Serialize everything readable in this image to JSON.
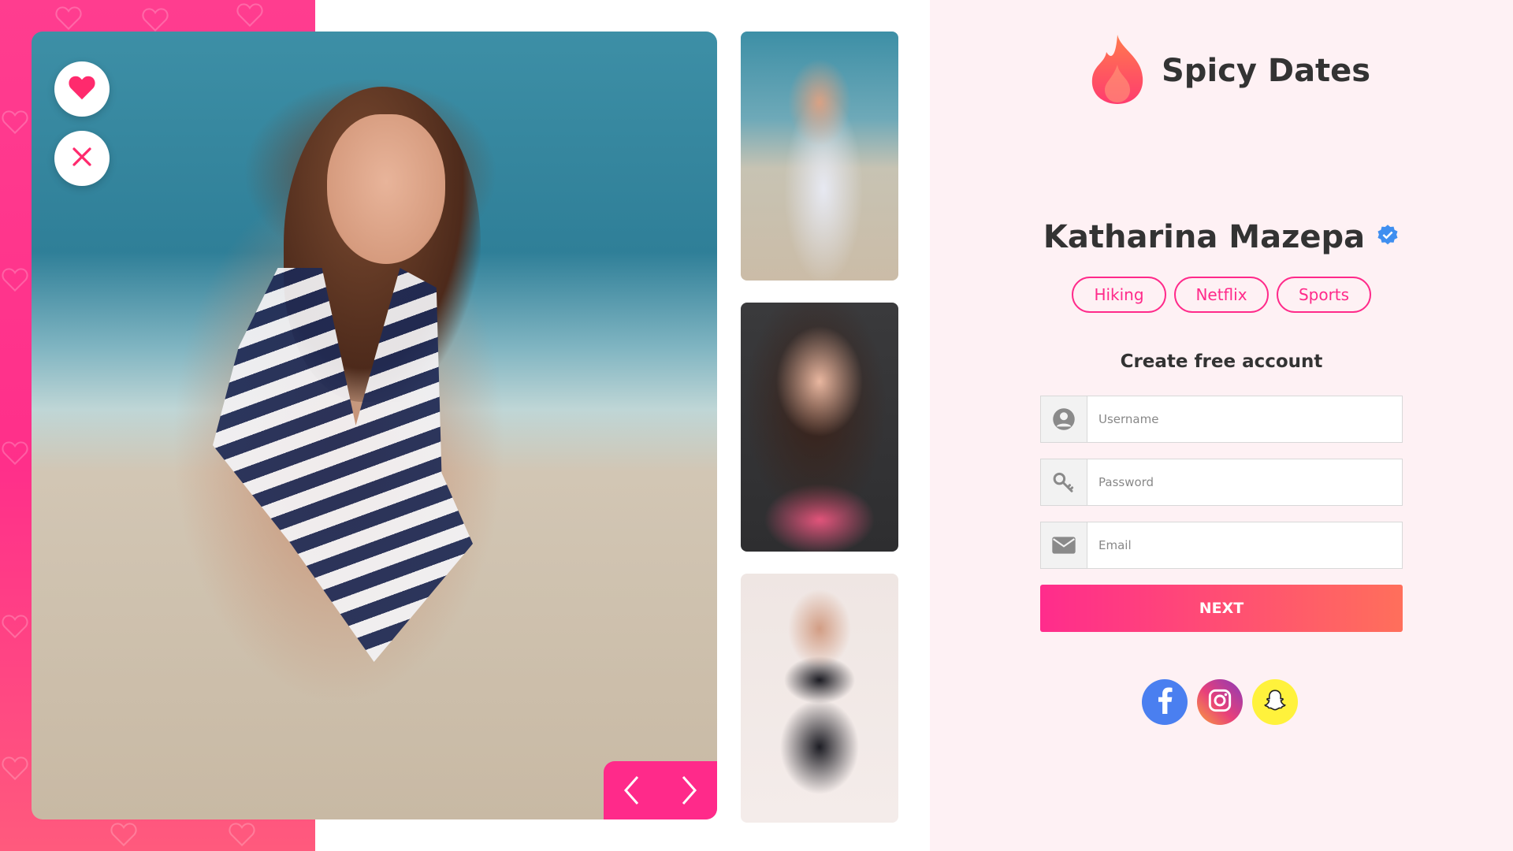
{
  "brand": {
    "name": "Spicy Dates",
    "logo_icon": "flame-icon"
  },
  "profile": {
    "name": "Katharina Mazepa",
    "verified_icon": "verified-badge-icon",
    "interests": [
      "Hiking",
      "Netflix",
      "Sports"
    ]
  },
  "photos": {
    "main_alt": "main-profile-photo",
    "thumbnails": [
      "thumbnail-1",
      "thumbnail-2",
      "thumbnail-3"
    ]
  },
  "actions": {
    "like_icon": "heart-icon",
    "dislike_icon": "close-icon",
    "prev_icon": "chevron-left-icon",
    "next_icon": "chevron-right-icon"
  },
  "form": {
    "title": "Create free account",
    "username_placeholder": "Username",
    "password_placeholder": "Password",
    "email_placeholder": "Email",
    "next_label": "NEXT"
  },
  "socials": [
    "facebook-icon",
    "instagram-icon",
    "snapchat-icon"
  ],
  "colors": {
    "accent": "#ff2a8a",
    "gradient_start": "#ff2c8c",
    "gradient_end": "#ff6f5b",
    "panel_bg": "#fef1f4",
    "facebook": "#4a7ff0",
    "snapchat": "#fff23c"
  }
}
